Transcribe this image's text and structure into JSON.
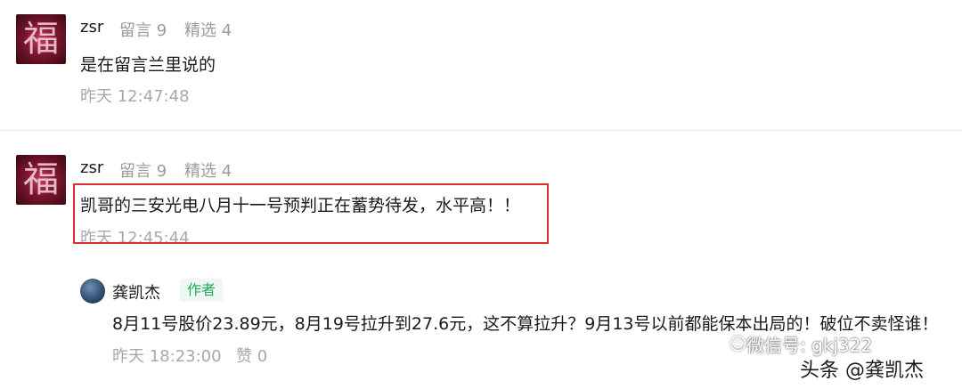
{
  "comments": [
    {
      "avatar_glyph": "福",
      "author": "zsr",
      "msg_count": "留言 9",
      "featured_count": "精选 4",
      "text": "是在留言兰里说的",
      "time": "昨天 12:47:48"
    },
    {
      "avatar_glyph": "福",
      "author": "zsr",
      "msg_count": "留言 9",
      "featured_count": "精选 4",
      "text": "凯哥的三安光电八月十一号预判正在蓄势待发，水平高！！",
      "time": "昨天 12:45:44",
      "reply": {
        "author": "龚凯杰",
        "badge": "作者",
        "text": "8月11号股价23.89元，8月19号拉升到27.6元，这不算拉升？9月13号以前都能保本出局的！破位不卖怪谁！",
        "time": "昨天 18:23:00",
        "likes": "赞 0"
      }
    }
  ],
  "watermark": {
    "wechat": "微信号: gkj322",
    "toutiao": "头条 @龚凯杰"
  },
  "colors": {
    "highlight_border": "#d9312f",
    "author_badge": "#1fae5a",
    "meta_gray": "#9b9b9b"
  }
}
